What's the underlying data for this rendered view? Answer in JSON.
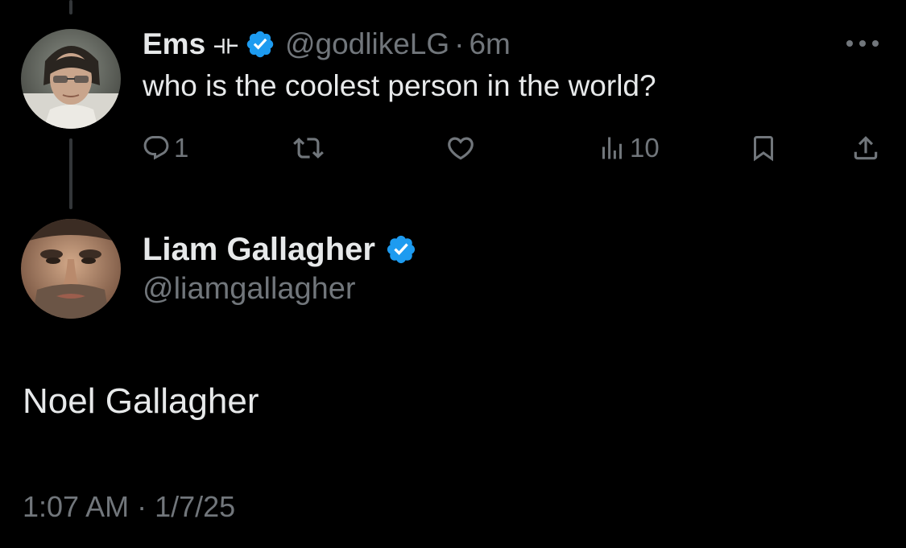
{
  "parent_tweet": {
    "author_name": "Ems",
    "author_flair": "⟛",
    "verified": true,
    "author_handle": "@godlikeLG",
    "separator": "·",
    "relative_time": "6m",
    "text": "who is the coolest person in the world?",
    "avatar_icon": "user-avatar-photo",
    "more_icon": "more-horizontal-icon",
    "actions": {
      "reply_count": "1",
      "retweet_count": "",
      "like_count": "",
      "views_count": "10"
    }
  },
  "reply_tweet": {
    "author_name": "Liam Gallagher",
    "verified": true,
    "author_handle": "@liamgallagher",
    "text": "Noel Gallagher",
    "timestamp": "1:07 AM · 1/7/25",
    "avatar_icon": "user-avatar-photo"
  },
  "colors": {
    "background": "#000000",
    "primary_text": "#e7e9ea",
    "secondary_text": "#71767b",
    "verified_blue": "#1d9bf0",
    "thread_line": "#333639"
  }
}
